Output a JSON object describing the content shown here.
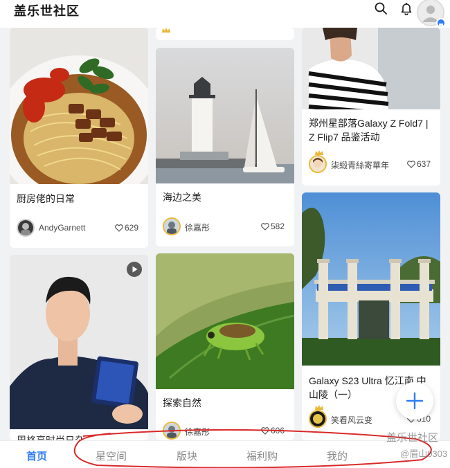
{
  "header": {
    "title": "盖乐世社区",
    "icons": [
      "search-icon",
      "bell-icon",
      "avatar-icon"
    ]
  },
  "posts": [
    {
      "title": "厨房佬的日常",
      "author": "AndyGarnett",
      "likes": "629"
    },
    {
      "title": "海边之美",
      "author": "徐嘉彤",
      "likes": "582"
    },
    {
      "title": "郑州星部落Galaxy Z Fold7 | Z Flip7 品鉴活动",
      "author": "柒緞青絲寄華年",
      "likes": "637"
    },
    {
      "title": "周格亮时尚日杂",
      "author": "",
      "likes": ""
    },
    {
      "title": "探索自然",
      "author": "徐嘉彤",
      "likes": "606"
    },
    {
      "title": "Galaxy S23 Ultra 忆江南 中山陵（一）",
      "author": "笑看风云变",
      "likes": "610"
    }
  ],
  "nav": {
    "items": [
      "首页",
      "星空间",
      "版块",
      "福利购",
      "我的"
    ],
    "active_index": 0
  },
  "watermark": {
    "line1": "盖乐世社区",
    "line2": "@眉山0303"
  },
  "colors": {
    "accent": "#2f7df6",
    "badge": "#e9b93a",
    "annotation": "#d92a2a"
  }
}
